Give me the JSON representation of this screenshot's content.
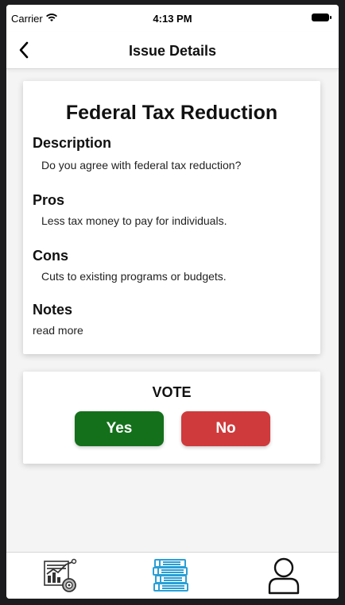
{
  "status_bar": {
    "carrier": "Carrier",
    "time": "4:13 PM",
    "wifi_icon": "wifi-icon",
    "battery_icon": "battery-icon"
  },
  "nav": {
    "title": "Issue Details",
    "back_icon": "chevron-left-icon"
  },
  "issue": {
    "title": "Federal Tax Reduction",
    "description_heading": "Description",
    "description_text": "Do you agree with federal tax reduction?",
    "pros_heading": "Pros",
    "pros_text": "Less tax money to pay for individuals.",
    "cons_heading": "Cons",
    "cons_text": "Cuts to existing programs or budgets.",
    "notes_heading": "Notes",
    "notes_text": "read more"
  },
  "vote": {
    "title": "VOTE",
    "yes_label": "Yes",
    "no_label": "No"
  },
  "tab_bar": {
    "items": [
      {
        "icon": "analytics-chart-icon"
      },
      {
        "icon": "books-stack-icon",
        "active": true
      },
      {
        "icon": "user-profile-icon"
      }
    ]
  },
  "colors": {
    "yes": "#14701b",
    "no": "#cf3a3c",
    "active_tab": "#2a9fd6"
  }
}
